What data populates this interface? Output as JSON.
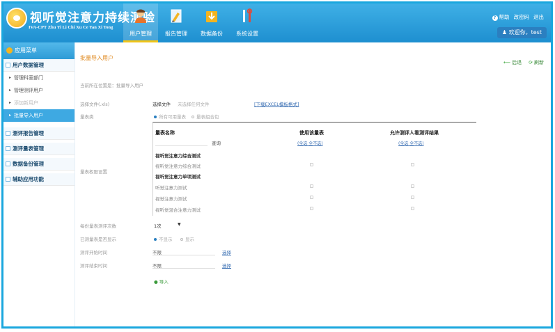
{
  "header": {
    "app_title": "视听觉注意力持续测验",
    "app_subtitle": "IVA-CPT Zhu Yi Li Chi Xu Ce Yan Xi Tong",
    "nav": [
      {
        "label": "用户管理",
        "icon": "users-icon",
        "active": true
      },
      {
        "label": "报告管理",
        "icon": "report-icon",
        "active": false
      },
      {
        "label": "数据备份",
        "icon": "backup-icon",
        "active": false
      },
      {
        "label": "系统设置",
        "icon": "settings-icon",
        "active": false
      }
    ],
    "help": "帮助",
    "change_password": "改密码",
    "logout": "退出",
    "welcome": "欢迎你，test"
  },
  "sidebar": {
    "title": "应用菜单",
    "groups": [
      {
        "label": "用户数据管理",
        "items": [
          "管理科室部门",
          "管理测评用户",
          "添加新用户",
          "批量导入用户"
        ]
      },
      {
        "label": "测评报告管理"
      },
      {
        "label": "测评量表管理"
      },
      {
        "label": "数据备份管理"
      },
      {
        "label": "辅助应用功能"
      }
    ]
  },
  "main": {
    "page_title": "批量导入用户",
    "toolbar": {
      "back": "后退",
      "refresh": "刷新"
    },
    "breadcrumb": "当前所在位置是：批量导入用户",
    "form": {
      "file_label": "选择文件(.xls)",
      "file_button": "选择文件",
      "file_status": "未选择任何文件",
      "download_link": "[下载EXCEL模板格式]",
      "scale_label": "量表类",
      "scale_option_all": "所有可用量表",
      "scale_option_group": "量表组合包",
      "permission_label": "量表权限设置",
      "limit_label": "每份量表测评次数",
      "limit_value": "1次",
      "finished_label": "已测量表是否显示",
      "finished_opt1": "不显示",
      "finished_opt2": "显示",
      "start_label": "测评开始时间",
      "start_value": "不限",
      "start_link": "选择",
      "end_label": "测评结束时间",
      "end_value": "不限",
      "end_link": "选择",
      "import_button": "导入"
    },
    "scale_table": {
      "headers": [
        "量表名称",
        "使用该量表",
        "允许测评人看测评结果"
      ],
      "query": "查询",
      "col2_links": "(全选 全不选)",
      "col3_links": "(全选 全不选)",
      "rows": [
        {
          "label": "视听觉注意力综合测试",
          "category": true
        },
        {
          "label": "视听觉注意力综合测试",
          "category": false
        },
        {
          "label": "视听觉注意力单项测试",
          "category": true
        },
        {
          "label": "听觉注意力测试",
          "category": false
        },
        {
          "label": "视觉注意力测试",
          "category": false
        },
        {
          "label": "视听觉混合注意力测试",
          "category": false
        }
      ]
    }
  }
}
